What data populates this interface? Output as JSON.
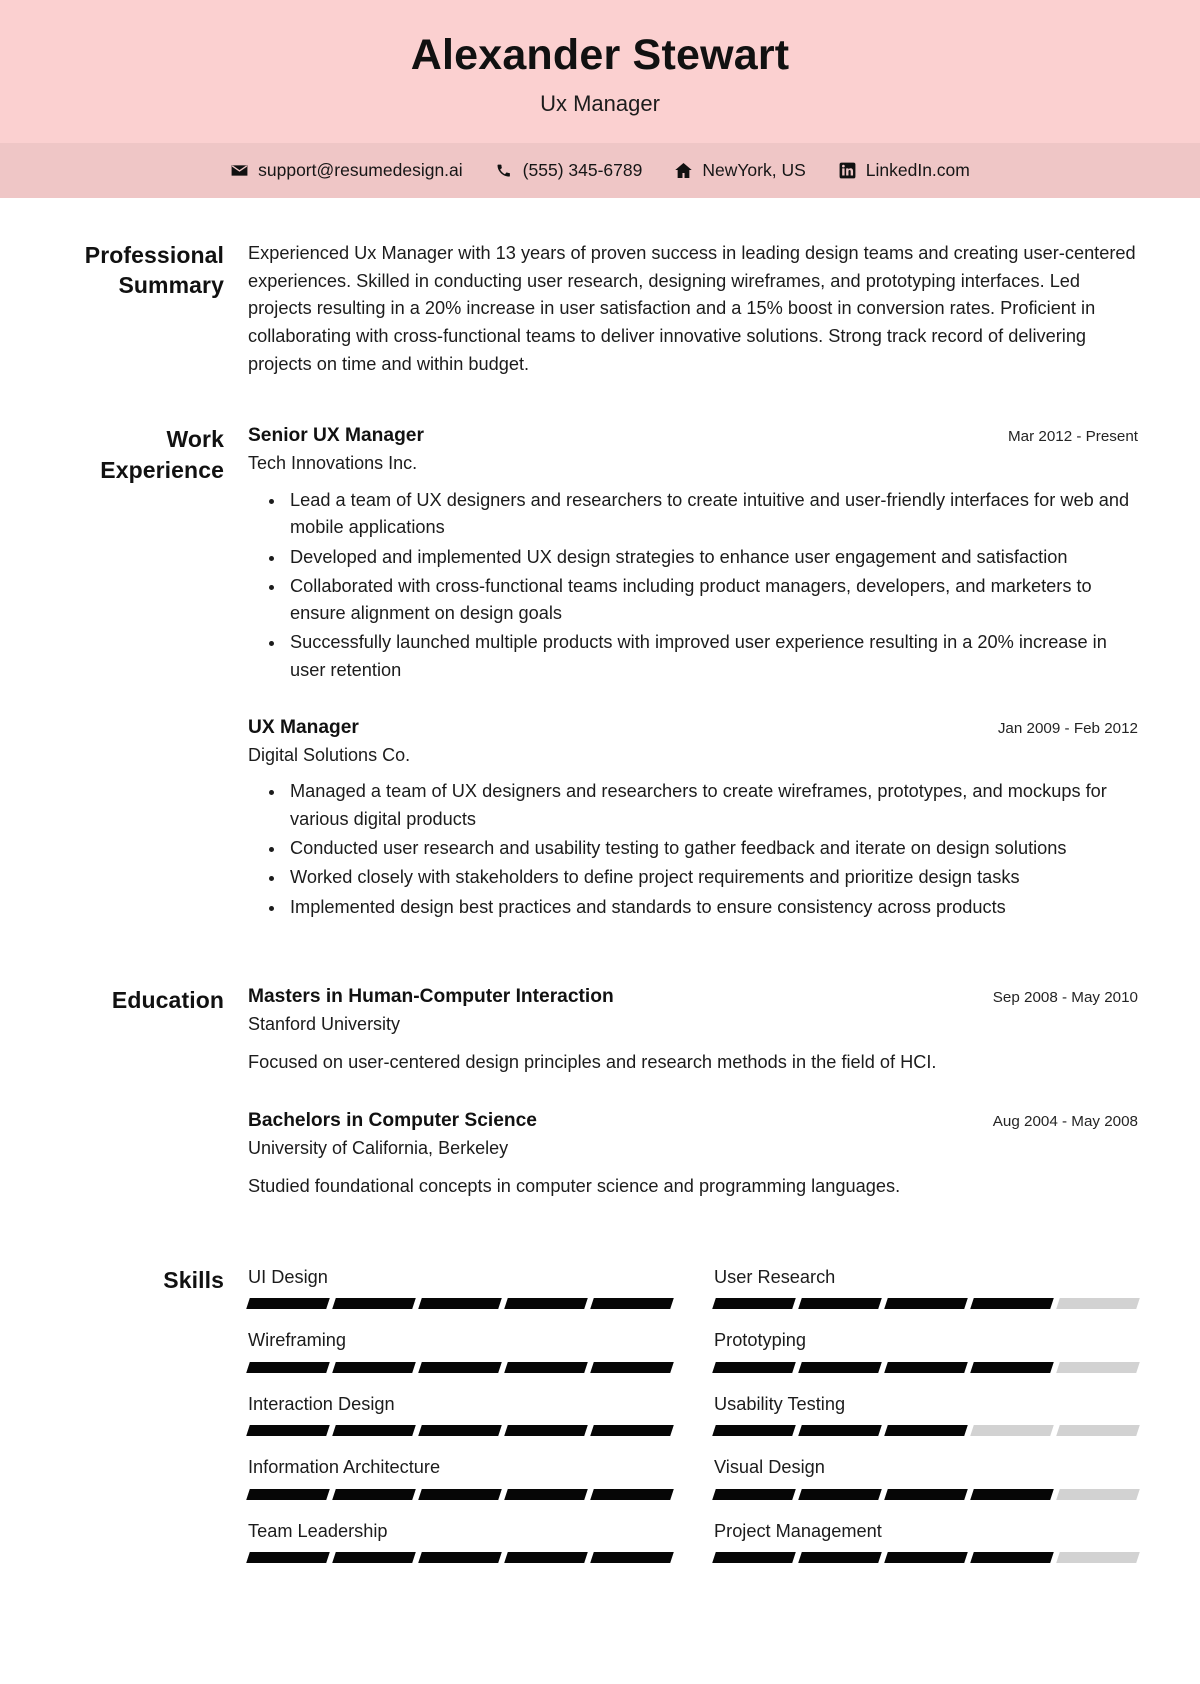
{
  "header": {
    "name": "Alexander Stewart",
    "title": "Ux Manager",
    "band_color": "#FBD0D0",
    "contact_band_color": "#EFC6C6"
  },
  "contact": [
    {
      "icon": "envelope-icon",
      "label": "support@resumedesign.ai"
    },
    {
      "icon": "phone-icon",
      "label": "(555) 345-6789"
    },
    {
      "icon": "home-icon",
      "label": "NewYork, US"
    },
    {
      "icon": "linkedin-icon",
      "label": "LinkedIn.com"
    }
  ],
  "summary": {
    "label": "Professional Summary",
    "text": "Experienced Ux Manager with 13 years of proven success in leading design teams and creating user-centered experiences. Skilled in conducting user research, designing wireframes, and prototyping interfaces. Led projects resulting in a 20% increase in user satisfaction and a 15% boost in conversion rates. Proficient in collaborating with cross-functional teams to deliver innovative solutions. Strong track record of delivering projects on time and within budget."
  },
  "experience": {
    "label": "Work Experience",
    "entries": [
      {
        "role": "Senior UX Manager",
        "org": "Tech Innovations Inc.",
        "date": "Mar 2012 - Present",
        "bullets": [
          "Lead a team of UX designers and researchers to create intuitive and user-friendly interfaces for web and mobile applications",
          "Developed and implemented UX design strategies to enhance user engagement and satisfaction",
          "Collaborated with cross-functional teams including product managers, developers, and marketers to ensure alignment on design goals",
          "Successfully launched multiple products with improved user experience resulting in a 20% increase in user retention"
        ]
      },
      {
        "role": "UX Manager",
        "org": "Digital Solutions Co.",
        "date": "Jan 2009 - Feb 2012",
        "bullets": [
          "Managed a team of UX designers and researchers to create wireframes, prototypes, and mockups for various digital products",
          "Conducted user research and usability testing to gather feedback and iterate on design solutions",
          "Worked closely with stakeholders to define project requirements and prioritize design tasks",
          "Implemented design best practices and standards to ensure consistency across products"
        ]
      }
    ]
  },
  "education": {
    "label": "Education",
    "entries": [
      {
        "degree": "Masters in Human-Computer Interaction",
        "school": "Stanford University",
        "date": "Sep 2008 - May 2010",
        "desc": "Focused on user-centered design principles and research methods in the field of HCI."
      },
      {
        "degree": "Bachelors in Computer Science",
        "school": "University of California, Berkeley",
        "date": "Aug 2004 - May 2008",
        "desc": "Studied foundational concepts in computer science and programming languages."
      }
    ]
  },
  "skills": {
    "label": "Skills",
    "max_level": 5,
    "filled_color": "#060606",
    "empty_color": "#D2D2D2",
    "items": [
      {
        "name": "UI Design",
        "level": 5
      },
      {
        "name": "User Research",
        "level": 4
      },
      {
        "name": "Wireframing",
        "level": 5
      },
      {
        "name": "Prototyping",
        "level": 4
      },
      {
        "name": "Interaction Design",
        "level": 5
      },
      {
        "name": "Usability Testing",
        "level": 3
      },
      {
        "name": "Information Architecture",
        "level": 5
      },
      {
        "name": "Visual Design",
        "level": 4
      },
      {
        "name": "Team Leadership",
        "level": 5
      },
      {
        "name": "Project Management",
        "level": 4
      }
    ]
  }
}
